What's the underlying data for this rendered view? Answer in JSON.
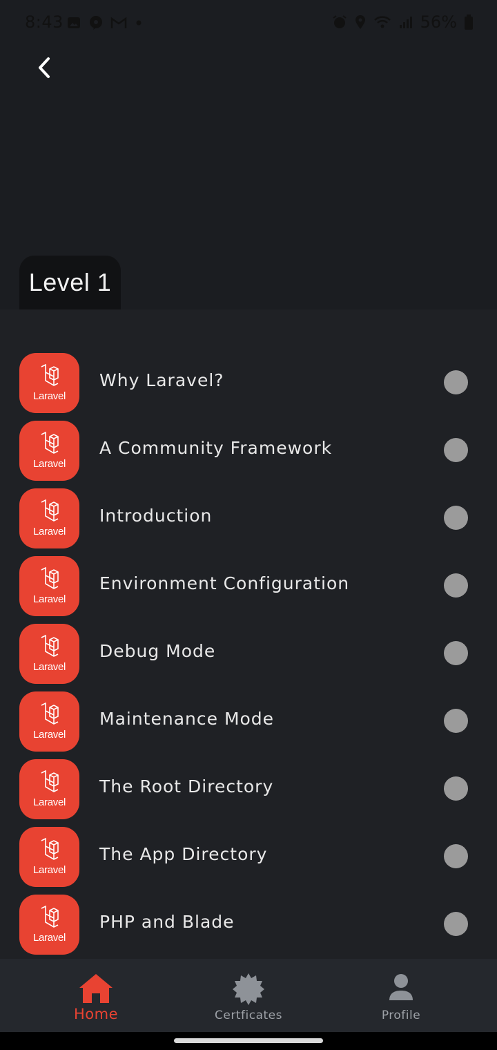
{
  "status_bar": {
    "time": "8:43",
    "battery": "56%"
  },
  "level": {
    "title": "Level 1"
  },
  "icon_brand_word": "Laravel",
  "lessons": [
    {
      "label": "Why Laravel?"
    },
    {
      "label": "A Community Framework"
    },
    {
      "label": "Introduction"
    },
    {
      "label": "Environment Configuration"
    },
    {
      "label": "Debug Mode"
    },
    {
      "label": "Maintenance Mode"
    },
    {
      "label": "The Root Directory"
    },
    {
      "label": "The App Directory"
    },
    {
      "label": "PHP and Blade"
    }
  ],
  "bottom_nav": {
    "home": "Home",
    "certificates": "Certficates",
    "profile": "Profile"
  },
  "colors": {
    "accent": "#e84332",
    "background": "#1b1d21",
    "list_background": "#1f2125",
    "status_dot": "#9b9b9b"
  }
}
